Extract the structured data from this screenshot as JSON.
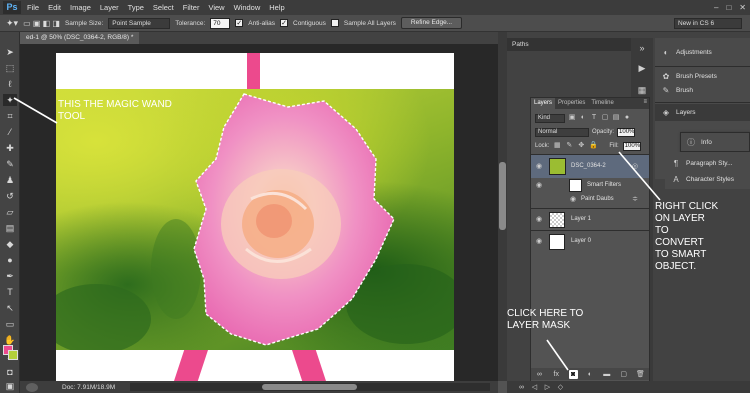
{
  "app": {
    "logo": "Ps"
  },
  "menu": [
    "File",
    "Edit",
    "Image",
    "Layer",
    "Type",
    "Select",
    "Filter",
    "View",
    "Window",
    "Help"
  ],
  "window_controls": [
    "–",
    "□",
    "✕"
  ],
  "options_bar": {
    "sample_size_label": "Sample Size:",
    "sample_size_value": "Point Sample",
    "tolerance_label": "Tolerance:",
    "tolerance_value": "70",
    "anti_alias": "Anti-alias",
    "contiguous": "Contiguous",
    "sample_all_layers": "Sample All Layers",
    "refine_edge": "Refine Edge...",
    "workspace": "New in CS 6"
  },
  "document": {
    "tab": "ed-1 @ 50% (DSC_0364-2, RGB/8) *"
  },
  "status": {
    "doc_size": "Doc: 7.91M/18.9M"
  },
  "colors": {
    "foreground": "#ec4a8d",
    "background": "#b3cf3c",
    "accent": "#ec4a8d"
  },
  "panels": {
    "paths": "Paths",
    "collapsed": [
      "Adjustments",
      "Brush Presets",
      "Brush",
      "Layers",
      "Info",
      "Paragraph Sty...",
      "Character Styles"
    ]
  },
  "layers_panel": {
    "tabs": [
      "Layers",
      "Properties",
      "Timeline"
    ],
    "filter_kind": "Kind",
    "blend_mode": "Normal",
    "opacity_label": "Opacity:",
    "opacity_value": "100%",
    "lock_label": "Lock:",
    "fill_label": "Fill:",
    "fill_value": "100%",
    "layers": [
      {
        "name": "DSC_0364-2"
      },
      {
        "name": "Smart Filters"
      },
      {
        "name": "Paint Daubs"
      },
      {
        "name": "Layer 1"
      },
      {
        "name": "Layer 0"
      }
    ]
  },
  "annotations": {
    "wand": [
      "THIS THE MAGIC WAND",
      "TOOL"
    ],
    "right_click": [
      "RIGHT CLICK",
      "ON LAYER",
      "TO",
      "CONVERT",
      "TO SMART",
      "OBJECT."
    ],
    "mask": [
      "CLICK HERE TO",
      "LAYER MASK"
    ]
  }
}
